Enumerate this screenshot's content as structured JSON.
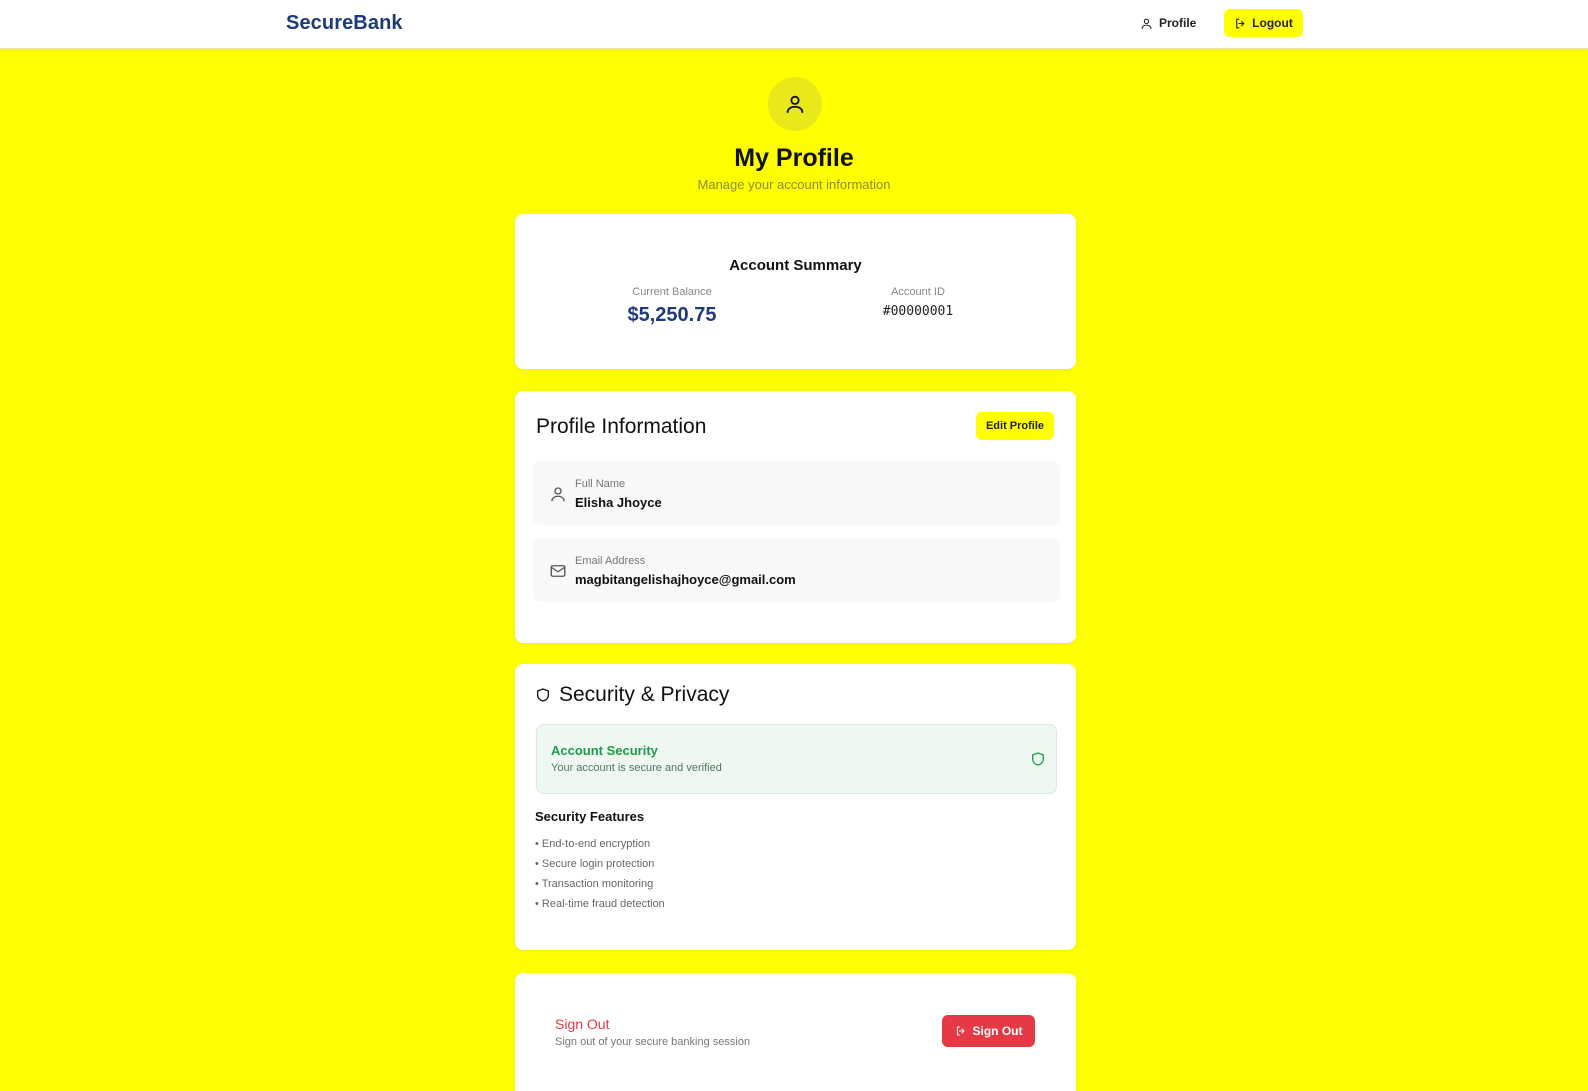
{
  "app": {
    "brand": "SecureBank"
  },
  "nav": {
    "profile_label": "Profile",
    "logout_label": "Logout"
  },
  "header": {
    "title": "My Profile",
    "subtitle": "Manage your account information"
  },
  "summary": {
    "title": "Account Summary",
    "balance_label": "Current Balance",
    "balance_value": "$5,250.75",
    "account_id_label": "Account ID",
    "account_id_value": "#00000001"
  },
  "profile": {
    "title": "Profile Information",
    "edit_label": "Edit Profile",
    "fields": [
      {
        "label": "Full Name",
        "value": "Elisha Jhoyce",
        "icon": "user-icon"
      },
      {
        "label": "Email Address",
        "value": "magbitangelishajhoyce@gmail.com",
        "icon": "mail-icon"
      }
    ]
  },
  "security": {
    "title": "Security & Privacy",
    "status_title": "Account Security",
    "status_desc": "Your account is secure and verified",
    "features_title": "Security Features",
    "features": [
      "• End-to-end encryption",
      "• Secure login protection",
      "• Transaction monitoring",
      "• Real-time fraud detection"
    ]
  },
  "signout": {
    "title": "Sign Out",
    "desc": "Sign out of your secure banking session",
    "button_label": "Sign Out"
  },
  "colors": {
    "background": "#ffff00",
    "brand": "#1e3a7b",
    "danger": "#e53946",
    "success": "#1f9a4b"
  }
}
